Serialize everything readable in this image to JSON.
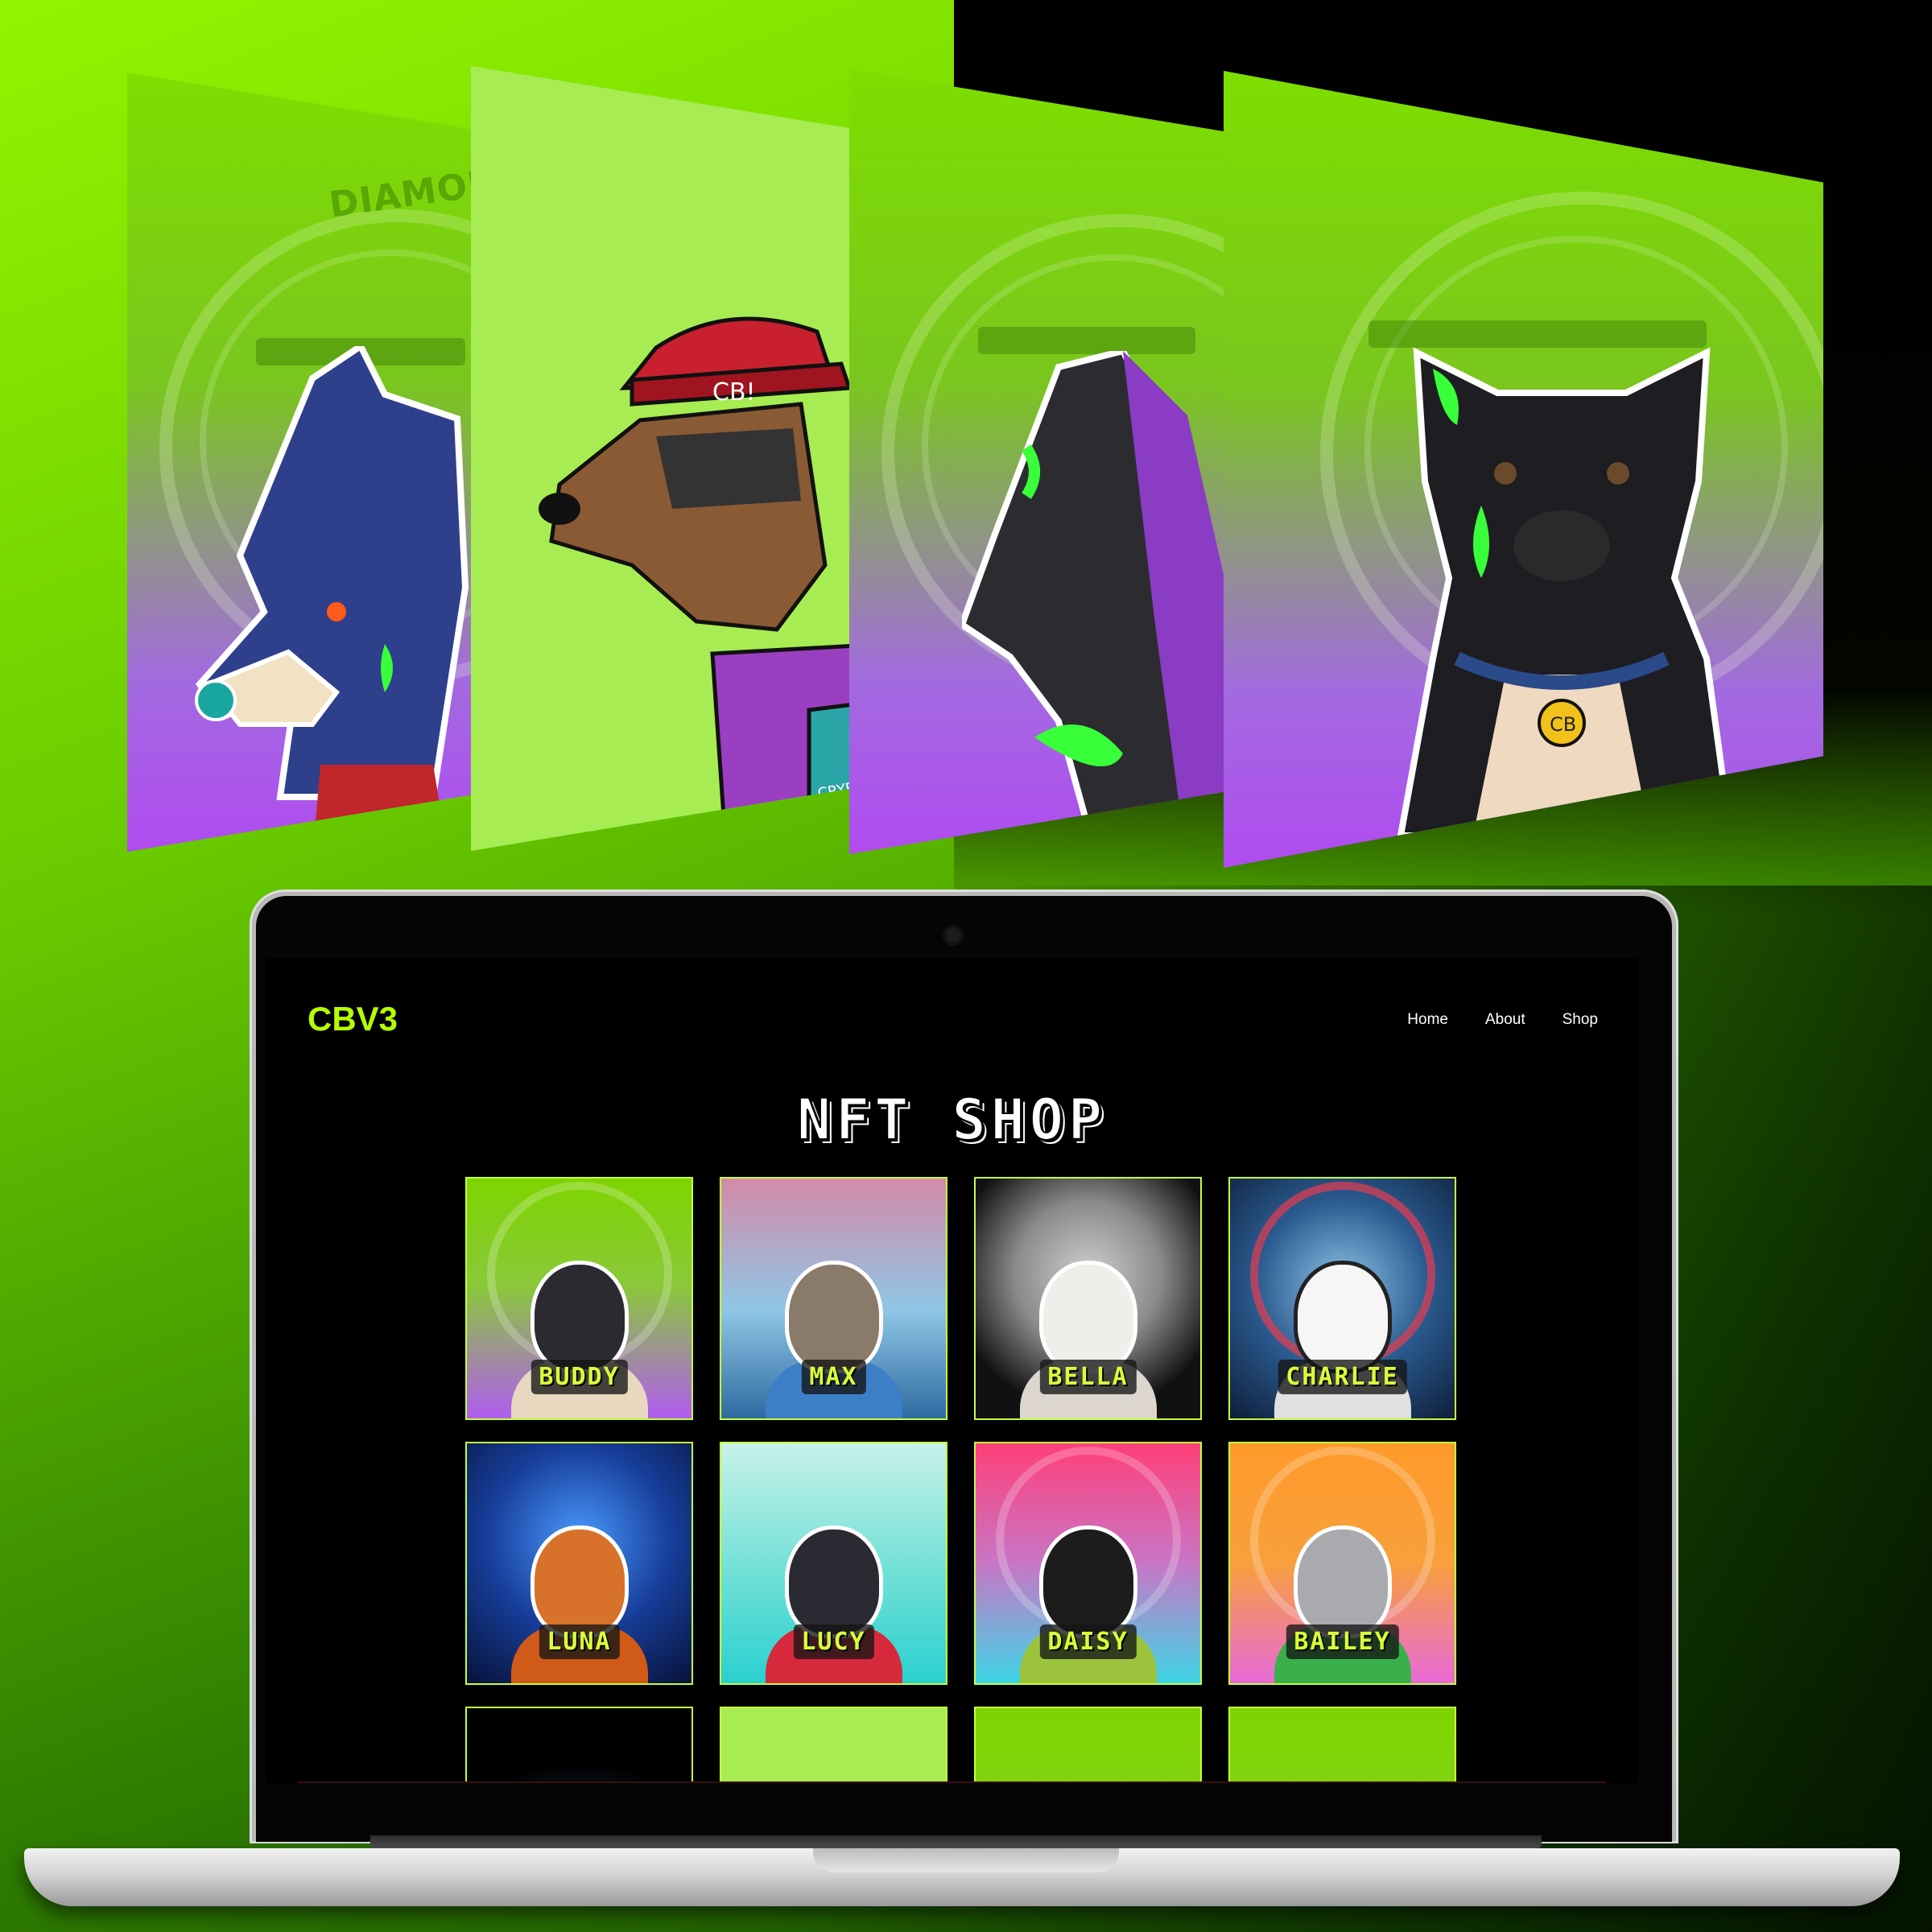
{
  "site": {
    "brand": "CBV3",
    "nav": [
      "Home",
      "About",
      "Shop"
    ],
    "title": "NFT SHOP"
  },
  "showcase": {
    "watermark": "DIAMONDH",
    "cap_text": "CB!",
    "sleeve_text": "CRYPTO BROTHERS",
    "tag_text": "CB"
  },
  "products": [
    {
      "name": "BUDDY",
      "bg": "green-purple",
      "fur": "#2a2a30",
      "body": "#e8d8c0"
    },
    {
      "name": "MAX",
      "bg": "pastel-sky",
      "fur": "#8a7a6a",
      "body": "#3c7fc6"
    },
    {
      "name": "BELLA",
      "bg": "moon",
      "fur": "#eeeeea",
      "body": "#ddd6cf"
    },
    {
      "name": "CHARLIE",
      "bg": "galaxy",
      "fur": "#f6f6f6",
      "body": "#e0e0e0"
    },
    {
      "name": "LUNA",
      "bg": "circuit-blue",
      "fur": "#d8722a",
      "body": "#d05a18"
    },
    {
      "name": "LUCY",
      "bg": "aqua",
      "fur": "#2a2a32",
      "body": "#d62a3c"
    },
    {
      "name": "DAISY",
      "bg": "pink-aqua",
      "fur": "#1c1c1c",
      "body": "#9bc43c"
    },
    {
      "name": "BAILEY",
      "bg": "orange",
      "fur": "#a8aaae",
      "body": "#3ab04a"
    },
    {
      "name": "",
      "bg": "planet",
      "fur": "",
      "body": ""
    },
    {
      "name": "",
      "bg": "lime",
      "fur": "",
      "body": ""
    },
    {
      "name": "",
      "bg": "green",
      "fur": "",
      "body": ""
    },
    {
      "name": "",
      "bg": "green",
      "fur": "",
      "body": ""
    }
  ],
  "colors": {
    "accent": "#b6ff00",
    "tile_border": "#c7ff3c",
    "name_text": "#d9ff3a"
  }
}
